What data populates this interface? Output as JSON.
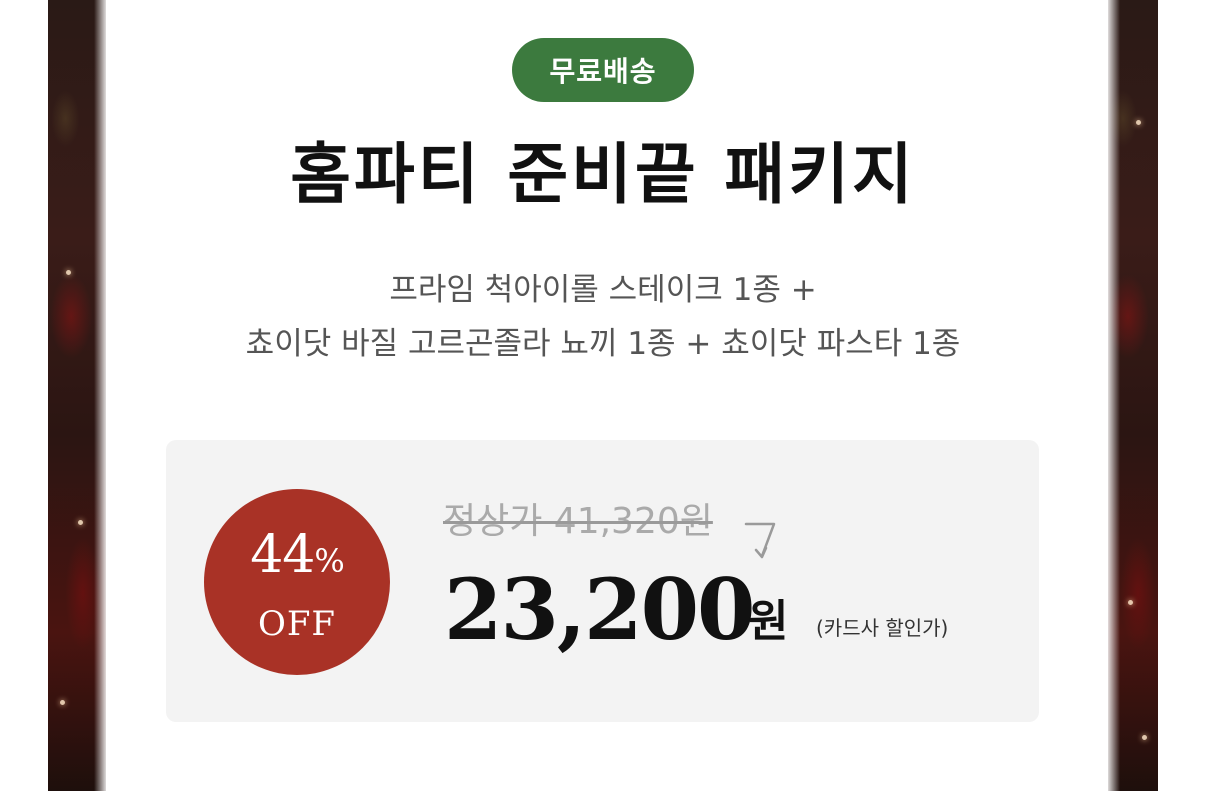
{
  "badge": {
    "label": "무료배송",
    "color": "#3c7a3e"
  },
  "product": {
    "title": "홈파티 준비끝 패키지",
    "desc_line1": "프라임 척아이롤 스테이크 1종 +",
    "desc_line2": "쵸이닷 바질 고르곤졸라 뇨끼 1종 + 쵸이닷 파스타 1종"
  },
  "pricing": {
    "discount_rate": "44",
    "discount_pct": "%",
    "discount_off": "OFF",
    "discount_color": "#a93226",
    "original_price": "정상가 41,320원",
    "sale_price": "23,200",
    "currency": "원",
    "note": "(카드사 할인가)"
  },
  "icons": {
    "arrow": "arrow-down-right-icon"
  }
}
